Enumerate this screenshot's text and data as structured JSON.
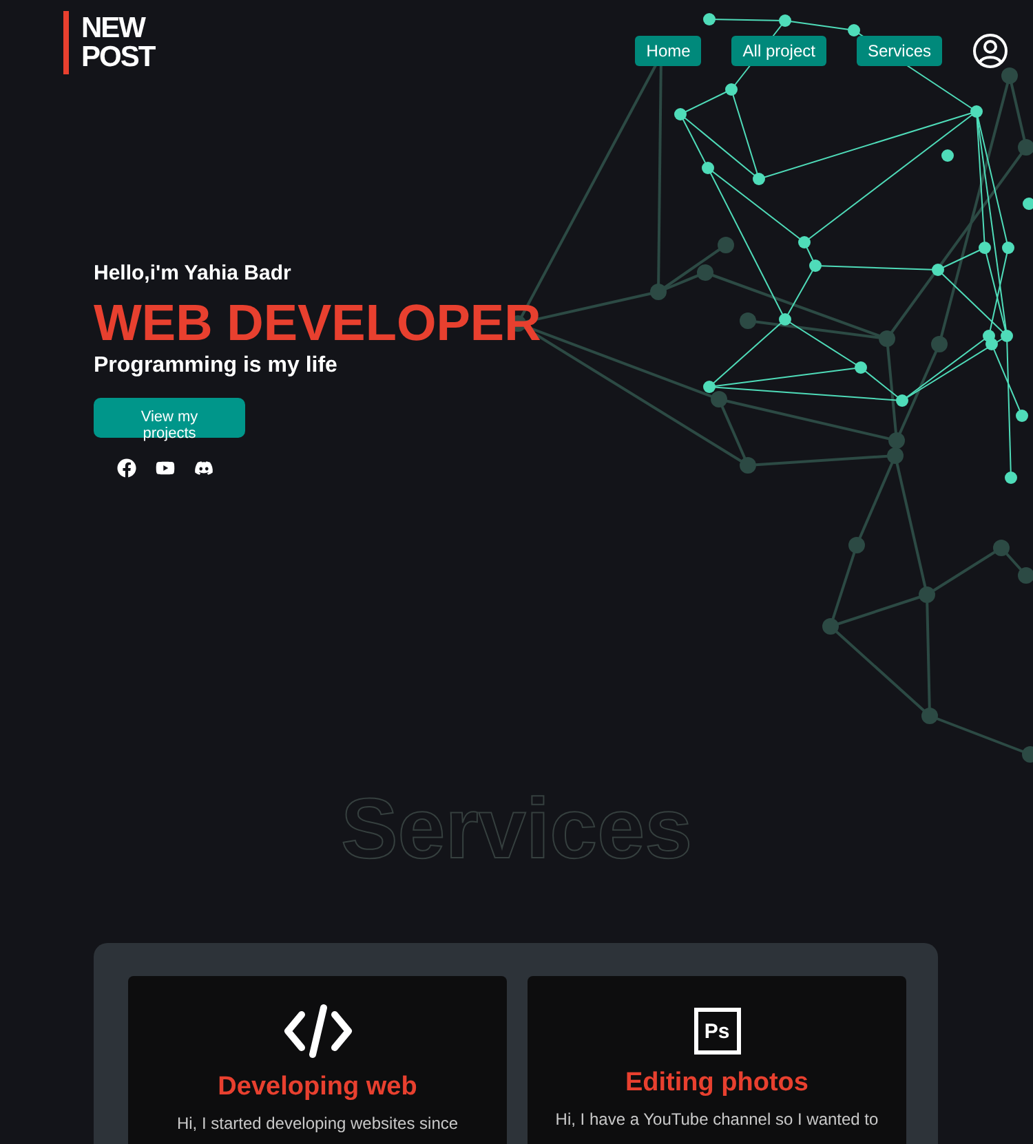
{
  "logo": {
    "line_1": "NEW",
    "line_2": "POST"
  },
  "nav": [
    {
      "label": "Home"
    },
    {
      "label": "All project"
    },
    {
      "label": "Services"
    }
  ],
  "hero": {
    "greeting": "Hello,i'm Yahia Badr",
    "title": "WEB DEVELOPER",
    "tagline": "Programming is my life",
    "button": "View my projects",
    "socials": [
      {
        "kind": "facebook"
      },
      {
        "kind": "youtube"
      },
      {
        "kind": "discord"
      }
    ]
  },
  "services": {
    "heading": "Services",
    "cards": [
      {
        "kind": "code",
        "title": "Developing web",
        "text": "Hi, I started developing websites since"
      },
      {
        "kind": "photoshop",
        "icon_text": "Ps",
        "title": "Editing photos",
        "text": "Hi, I have a YouTube channel so I wanted to"
      }
    ]
  }
}
